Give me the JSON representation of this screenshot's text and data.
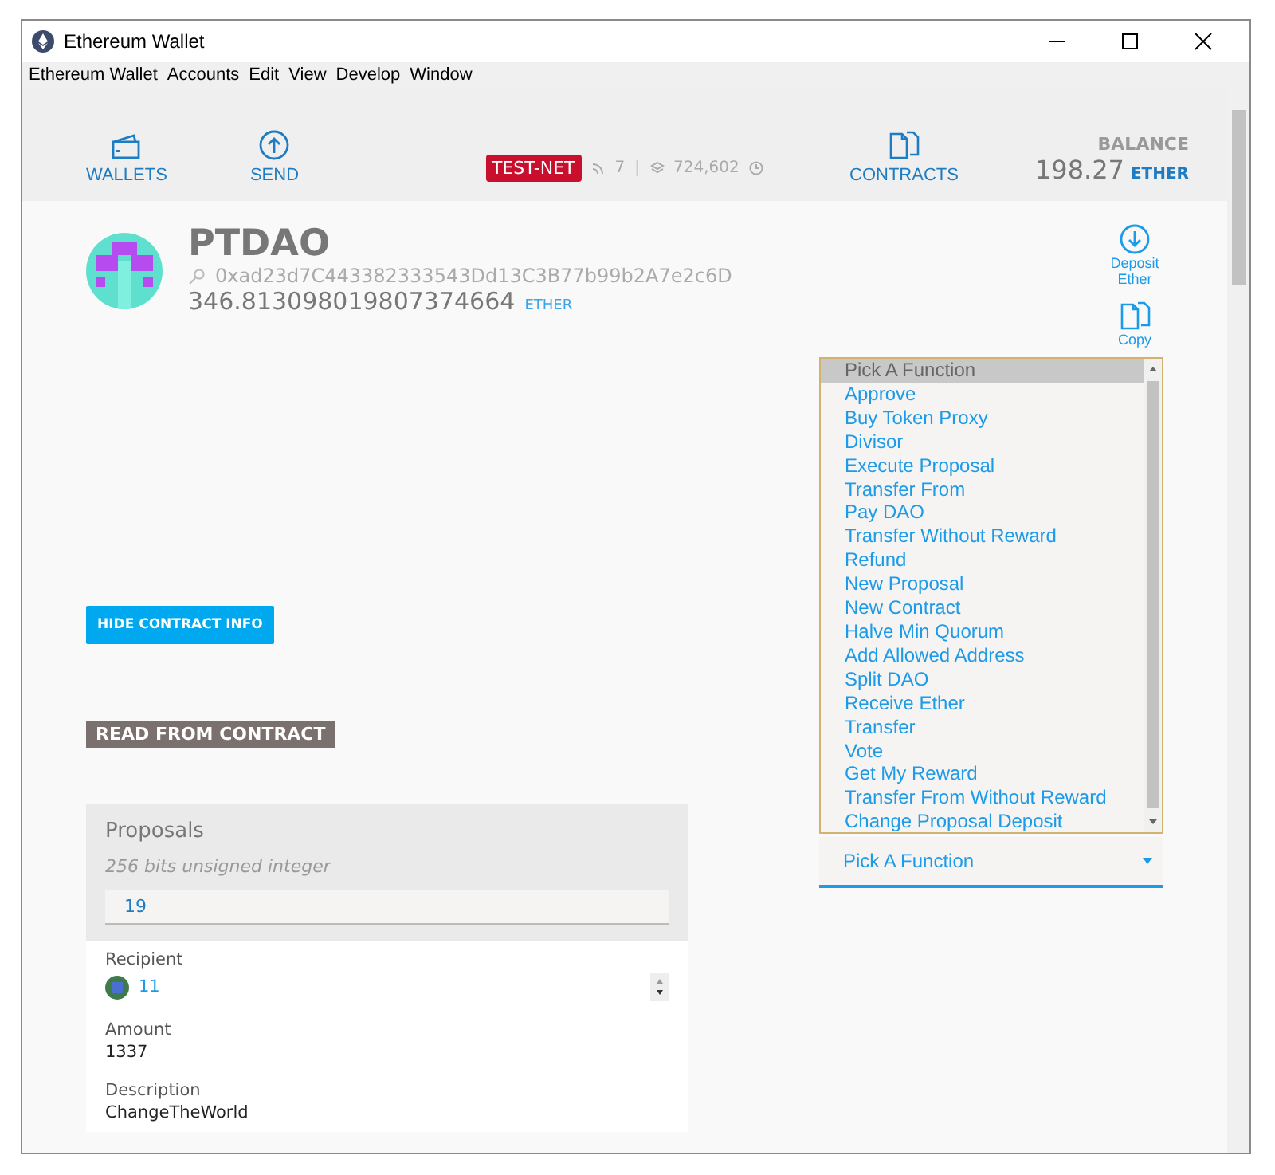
{
  "window": {
    "title": "Ethereum Wallet"
  },
  "menu": [
    "Ethereum Wallet",
    "Accounts",
    "Edit",
    "View",
    "Develop",
    "Window"
  ],
  "nav": [
    {
      "label": "WALLETS",
      "kind": "wallet"
    },
    {
      "label": "SEND",
      "kind": "send"
    }
  ],
  "network": {
    "badge": "TEST-NET",
    "peers": "7",
    "separator": "|",
    "block": "724,602"
  },
  "nav_right": {
    "label": "CONTRACTS"
  },
  "balance": {
    "label": "BALANCE",
    "amount": "198.27",
    "unit": "ETHER"
  },
  "contract": {
    "name": "PTDAO",
    "address": "0xad23d7C443382333543Dd13C3B77b99b2A7e2c6D",
    "amount": "346.813098019807374664",
    "unit": "ETHER"
  },
  "actions": [
    {
      "label": "Deposit Ether",
      "kind": "deposit"
    },
    {
      "label": "Copy",
      "kind": "copy"
    }
  ],
  "hide_button": "HIDE CONTRACT INFO",
  "read_heading": "READ FROM CONTRACT",
  "proposals": {
    "title": "Proposals",
    "hint": "256 bits unsigned integer",
    "value": "19",
    "fields": [
      {
        "label": "Recipient",
        "value": "11",
        "kind": "address"
      },
      {
        "label": "Amount",
        "value": "1337",
        "kind": "text"
      },
      {
        "label": "Description",
        "value": "ChangeTheWorld",
        "kind": "text"
      }
    ]
  },
  "function_select": {
    "value": "Pick A Function",
    "options": [
      {
        "label": "Pick A Function",
        "selected": true
      },
      {
        "label": "Approve",
        "selected": false
      },
      {
        "label": "Buy Token Proxy",
        "selected": false
      },
      {
        "label": "Divisor",
        "selected": false
      },
      {
        "label": "Execute Proposal",
        "selected": false
      },
      {
        "label": "Transfer From",
        "selected": false
      },
      {
        "label": "Pay DAO",
        "selected": false
      },
      {
        "label": "Transfer Without Reward",
        "selected": false
      },
      {
        "label": "Refund",
        "selected": false
      },
      {
        "label": "New Proposal",
        "selected": false
      },
      {
        "label": "New Contract",
        "selected": false
      },
      {
        "label": "Halve Min Quorum",
        "selected": false
      },
      {
        "label": "Add Allowed Address",
        "selected": false
      },
      {
        "label": "Split DAO",
        "selected": false
      },
      {
        "label": "Receive Ether",
        "selected": false
      },
      {
        "label": "Transfer",
        "selected": false
      },
      {
        "label": "Vote",
        "selected": false
      },
      {
        "label": "Get My Reward",
        "selected": false
      },
      {
        "label": "Transfer From Without Reward",
        "selected": false
      },
      {
        "label": "Change Proposal Deposit",
        "selected": false
      }
    ]
  }
}
